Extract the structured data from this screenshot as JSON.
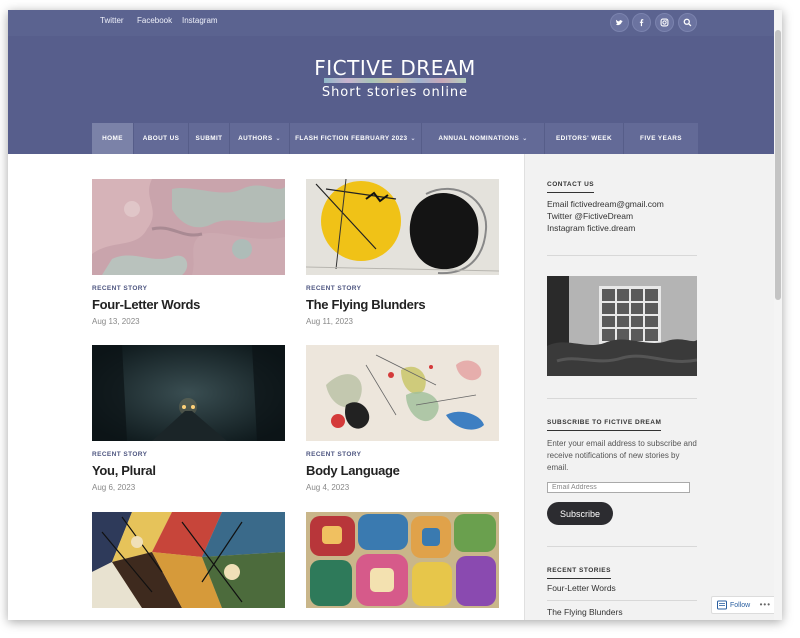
{
  "topbar": {
    "social_links": [
      "Twitter",
      "Facebook",
      "Instagram"
    ],
    "icons": [
      "twitter-icon",
      "facebook-icon",
      "instagram-icon",
      "search-icon"
    ]
  },
  "header": {
    "title": "FICTIVE DREAM",
    "tagline": "Short stories online"
  },
  "nav": {
    "items": [
      {
        "label": "HOME",
        "active": true
      },
      {
        "label": "ABOUT US"
      },
      {
        "label": "SUBMIT"
      },
      {
        "label": "AUTHORS",
        "dropdown": true
      },
      {
        "label": "FLASH FICTION FEBRUARY 2023",
        "dropdown": true
      },
      {
        "label": "ANNUAL NOMINATIONS",
        "dropdown": true
      },
      {
        "label": "EDITORS' WEEK"
      },
      {
        "label": "FIVE YEARS"
      }
    ]
  },
  "posts": [
    {
      "category": "RECENT STORY",
      "title": "Four-Letter Words",
      "date": "Aug 13, 2023"
    },
    {
      "category": "RECENT STORY",
      "title": "The Flying Blunders",
      "date": "Aug 11, 2023"
    },
    {
      "category": "RECENT STORY",
      "title": "You, Plural",
      "date": "Aug 6, 2023"
    },
    {
      "category": "RECENT STORY",
      "title": "Body Language",
      "date": "Aug 4, 2023"
    },
    {
      "category": "",
      "title": "",
      "date": ""
    },
    {
      "category": "",
      "title": "",
      "date": ""
    }
  ],
  "sidebar": {
    "contact": {
      "title": "CONTACT US",
      "lines": [
        "Email fictivedream@gmail.com",
        "Twitter @FictiveDream",
        "Instagram fictive.dream"
      ]
    },
    "subscribe": {
      "title": "SUBSCRIBE TO FICTIVE DREAM",
      "text": "Enter your email address to subscribe and receive notifications of new stories by email.",
      "placeholder": "Email Address",
      "button": "Subscribe"
    },
    "recent": {
      "title": "RECENT STORIES",
      "items": [
        "Four-Letter Words",
        "The Flying Blunders"
      ]
    }
  },
  "follow": {
    "label": "Follow",
    "more": "•••"
  },
  "colors": {
    "header": "#575e8c",
    "topbar": "#5b6390",
    "nav": "#636a97",
    "accent": "#4d5580"
  }
}
